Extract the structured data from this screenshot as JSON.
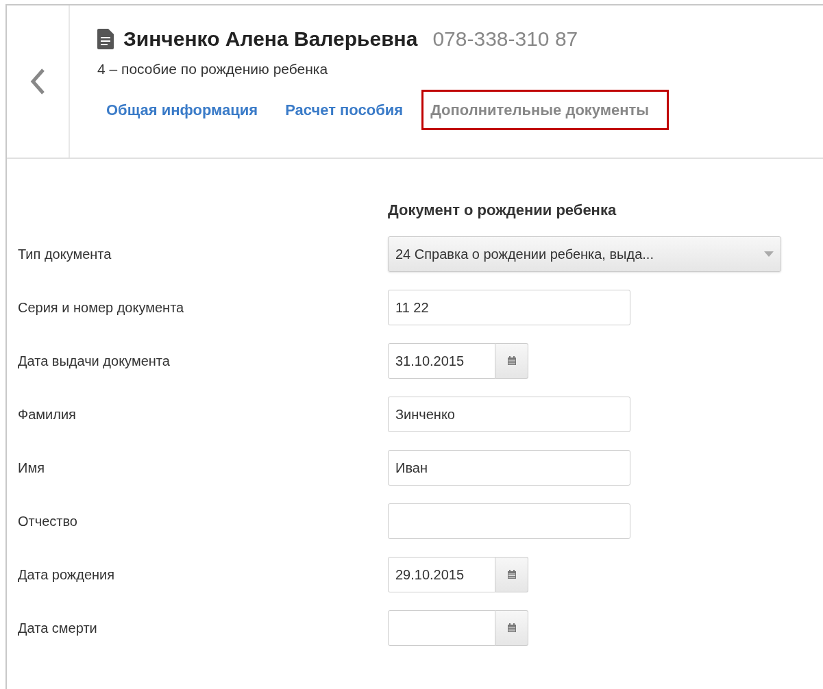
{
  "header": {
    "name": "Зинченко Алена Валерьевна",
    "number": "078-338-310 87",
    "subtitle": "4 – пособие по рождению ребенка"
  },
  "tabs": [
    {
      "label": "Общая информация",
      "selected": false,
      "highlighted": false
    },
    {
      "label": "Расчет пособия",
      "selected": false,
      "highlighted": false
    },
    {
      "label": "Дополнительные документы",
      "selected": true,
      "highlighted": true
    }
  ],
  "section": {
    "title": "Документ о рождении ребенка"
  },
  "fields": [
    {
      "kind": "select",
      "label": "Тип документа",
      "value": "24 Справка о рождении ребенка, выда..."
    },
    {
      "kind": "text",
      "label": "Серия и номер документа",
      "value": "11 22"
    },
    {
      "kind": "date",
      "label": "Дата выдачи документа",
      "value": "31.10.2015"
    },
    {
      "kind": "text",
      "label": "Фамилия",
      "value": "Зинченко"
    },
    {
      "kind": "text",
      "label": "Имя",
      "value": "Иван"
    },
    {
      "kind": "text",
      "label": "Отчество"
    },
    {
      "kind": "date",
      "label": "Дата рождения",
      "value": "29.10.2015"
    },
    {
      "kind": "date",
      "label": "Дата смерти"
    }
  ]
}
